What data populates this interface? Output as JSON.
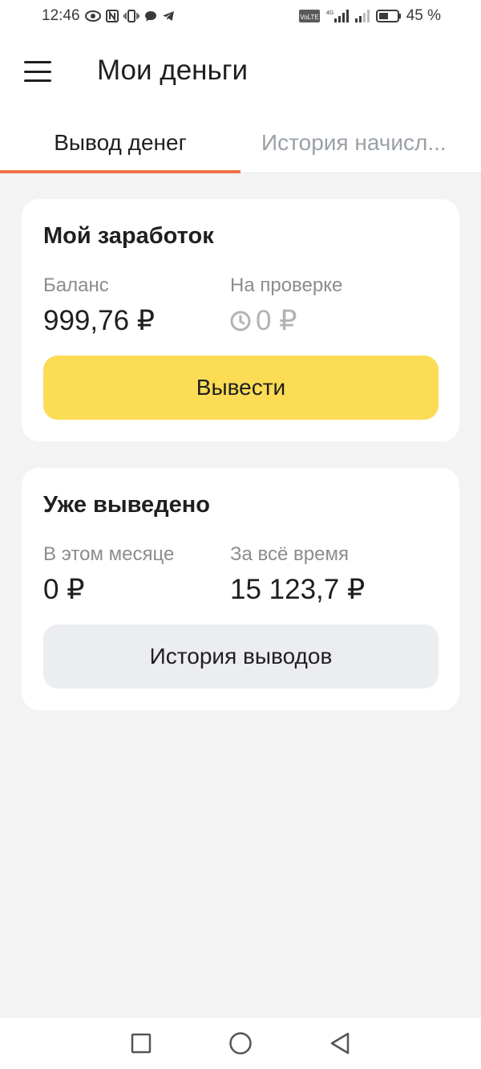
{
  "status_bar": {
    "time": "12:46",
    "battery": "45 %",
    "volte": "VoLTE",
    "network": "4G",
    "icons": [
      "eye-icon",
      "nfc-icon",
      "vibrate-icon",
      "message-icon",
      "telegram-icon",
      "volte-icon",
      "signal-icon",
      "battery-icon"
    ]
  },
  "header": {
    "title": "Мои деньги",
    "menu_icon": "hamburger-menu-icon"
  },
  "tabs": [
    {
      "label": "Вывод денег",
      "active": true
    },
    {
      "label": "История начисл...",
      "active": false
    }
  ],
  "accent_color": "#f0734a",
  "earnings": {
    "title": "Мой заработок",
    "balance_label": "Баланс",
    "balance_value": "999,76 ₽",
    "pending_label": "На проверке",
    "pending_value": "0 ₽",
    "pending_icon": "clock-icon",
    "withdraw_button": "Вывести",
    "withdraw_button_color": "#fcdb55"
  },
  "withdrawn": {
    "title": "Уже выведено",
    "month_label": "В этом месяце",
    "month_value": "0 ₽",
    "total_label": "За всё время",
    "total_value": "15 123,7 ₽",
    "history_button": "История выводов"
  },
  "nav_bar": {
    "icons": [
      "square-recent-apps-icon",
      "circle-home-icon",
      "triangle-back-icon"
    ]
  }
}
